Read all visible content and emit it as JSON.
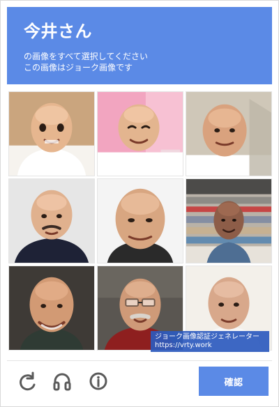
{
  "header": {
    "title": "今井さん",
    "subtitle_line1": "の画像をすべて選択してください",
    "subtitle_line2": "この画像はジョーク画像です"
  },
  "watermark": {
    "line1": "ジョーク画像認証ジェネレーター",
    "line2": "https://vrty.work"
  },
  "footer": {
    "confirm_label": "確認",
    "icons": {
      "reload": "reload-icon",
      "audio": "headphones-icon",
      "info": "info-icon"
    }
  },
  "colors": {
    "accent": "#5b8ae6",
    "watermark": "#2d5abe"
  }
}
